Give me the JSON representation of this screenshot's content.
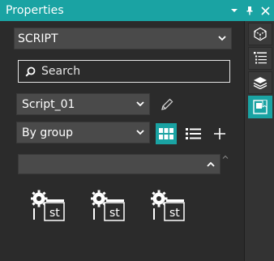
{
  "window": {
    "title": "Properties"
  },
  "type_combo": {
    "value": "SCRIPT"
  },
  "search": {
    "placeholder": "Search"
  },
  "script_combo": {
    "value": "Script_01"
  },
  "group_combo": {
    "value": "By group"
  },
  "items": [
    {
      "icon": "script-st-icon",
      "label": "st"
    },
    {
      "icon": "script-st-icon",
      "label": "st"
    },
    {
      "icon": "script-st-icon",
      "label": "st"
    }
  ],
  "sidebar": [
    "3d-object-icon",
    "list-tree-icon",
    "layers-icon",
    "properties-icon"
  ],
  "colors": {
    "accent": "#1aa3a3",
    "panel": "#2b2b2b",
    "control": "#4a4a4a"
  }
}
